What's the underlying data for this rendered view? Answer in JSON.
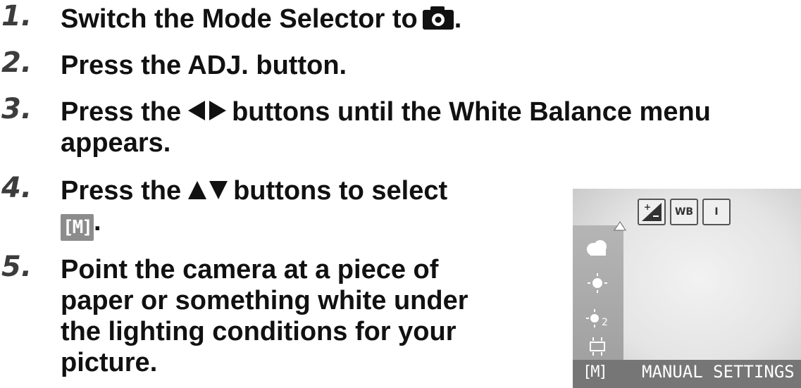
{
  "steps": [
    {
      "number": "1.",
      "lines": [
        "Switch the Mode Selector to",
        "."
      ]
    },
    {
      "number": "2.",
      "lines": [
        "Press the ADJ. button."
      ]
    },
    {
      "number": "3.",
      "lines": [
        "Press the",
        "buttons until the White Balance menu",
        "appears."
      ]
    },
    {
      "number": "4.",
      "lines": [
        "Press the",
        "buttons to select",
        "[M]",
        "."
      ]
    },
    {
      "number": "5.",
      "lines": [
        "Point the camera at a piece of",
        "paper or something white under",
        "the lighting conditions for your",
        "picture."
      ]
    }
  ],
  "lcd": {
    "top_icons": [
      "",
      "WB",
      "I"
    ],
    "menu_items": [
      "",
      "",
      "2",
      ""
    ],
    "selected_icon": "[M]",
    "selected_label": "MANUAL SETTINGS"
  }
}
